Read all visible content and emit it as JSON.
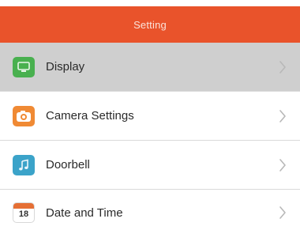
{
  "header": {
    "title": "Setting"
  },
  "colors": {
    "header_bg": "#e9532b",
    "selected_row_bg": "#cfcfcf",
    "display_icon": "#49b04f",
    "camera_icon": "#f08a34",
    "doorbell_icon": "#3ba3c9",
    "date_icon": "#e56f34"
  },
  "items": [
    {
      "label": "Display",
      "icon": "display-icon"
    },
    {
      "label": "Camera Settings",
      "icon": "camera-icon"
    },
    {
      "label": "Doorbell",
      "icon": "music-note-icon"
    },
    {
      "label": "Date and Time",
      "icon": "calendar-icon",
      "icon_text": "18"
    }
  ]
}
